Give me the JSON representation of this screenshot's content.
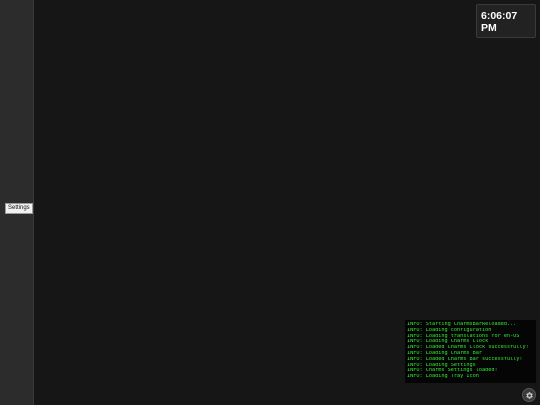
{
  "charms_bar": {
    "settings_tooltip": "Settings"
  },
  "clock": {
    "time_line1": "6:06:07",
    "time_line2": "PM"
  },
  "log": {
    "lines": [
      "INFO: Starting CharmsBarReloaded...",
      "INFO: Loading configuration",
      "INFO: Loading translations for en-US",
      "INFO: Loading Charms Clock",
      "INFO: Loaded Charms Clock successfully!",
      "INFO: Loading Charms Bar",
      "INFO: Loaded Charms Bar successfully!",
      "INFO: Loading Settings",
      "INFO: Charms Settings loaded!",
      "INFO: Loading Tray Icon"
    ]
  },
  "tray": {
    "icon": "gear-icon"
  },
  "colors": {
    "background": "#161616",
    "charms_bar": "#2c2c2c",
    "log_text": "#33ee33"
  }
}
